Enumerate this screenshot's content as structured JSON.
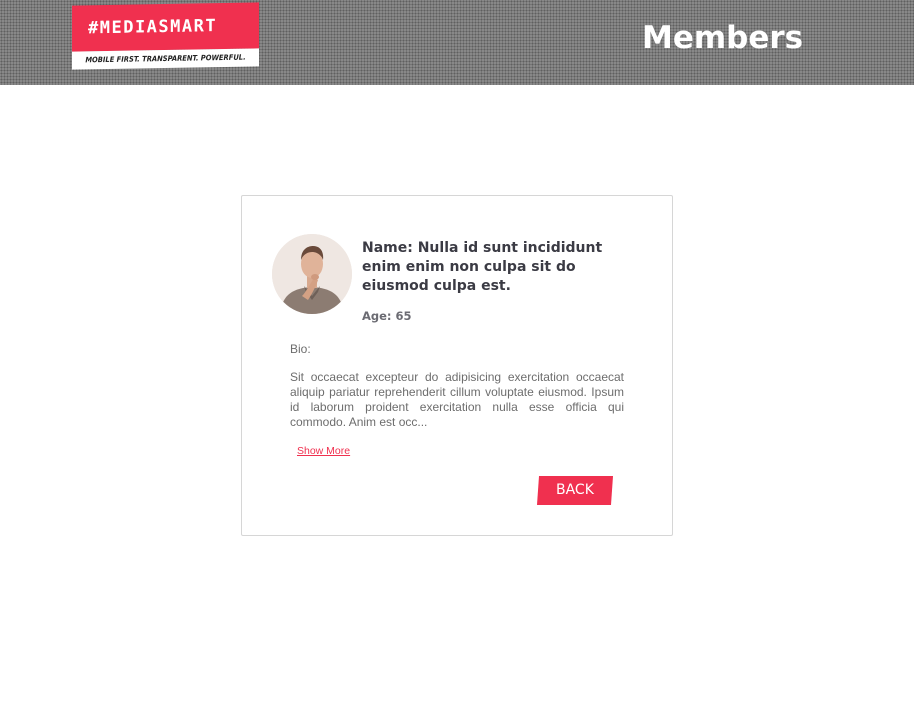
{
  "header": {
    "logo": {
      "brand": "#MEDIASMART",
      "tagline": "MOBILE FIRST. TRANSPARENT. POWERFUL."
    },
    "title": "Members"
  },
  "member": {
    "name": "Name: Nulla id sunt incididunt enim enim non culpa sit do eiusmod culpa est.",
    "age": "Age: 65",
    "bio_label": "Bio:",
    "bio_text": "Sit occaecat excepteur do adipisicing exercitation occaecat aliquip pariatur reprehenderit cillum voluptate eiusmod. Ipsum id laborum proident exercitation nulla esse officia qui commodo. Anim est occ...",
    "show_more_label": "Show More",
    "back_label": "BACK"
  },
  "colors": {
    "accent": "#f0304f",
    "header_bg": "#8a8a8a",
    "name_text": "#3b3b44",
    "body_text": "#6d6d6d"
  }
}
